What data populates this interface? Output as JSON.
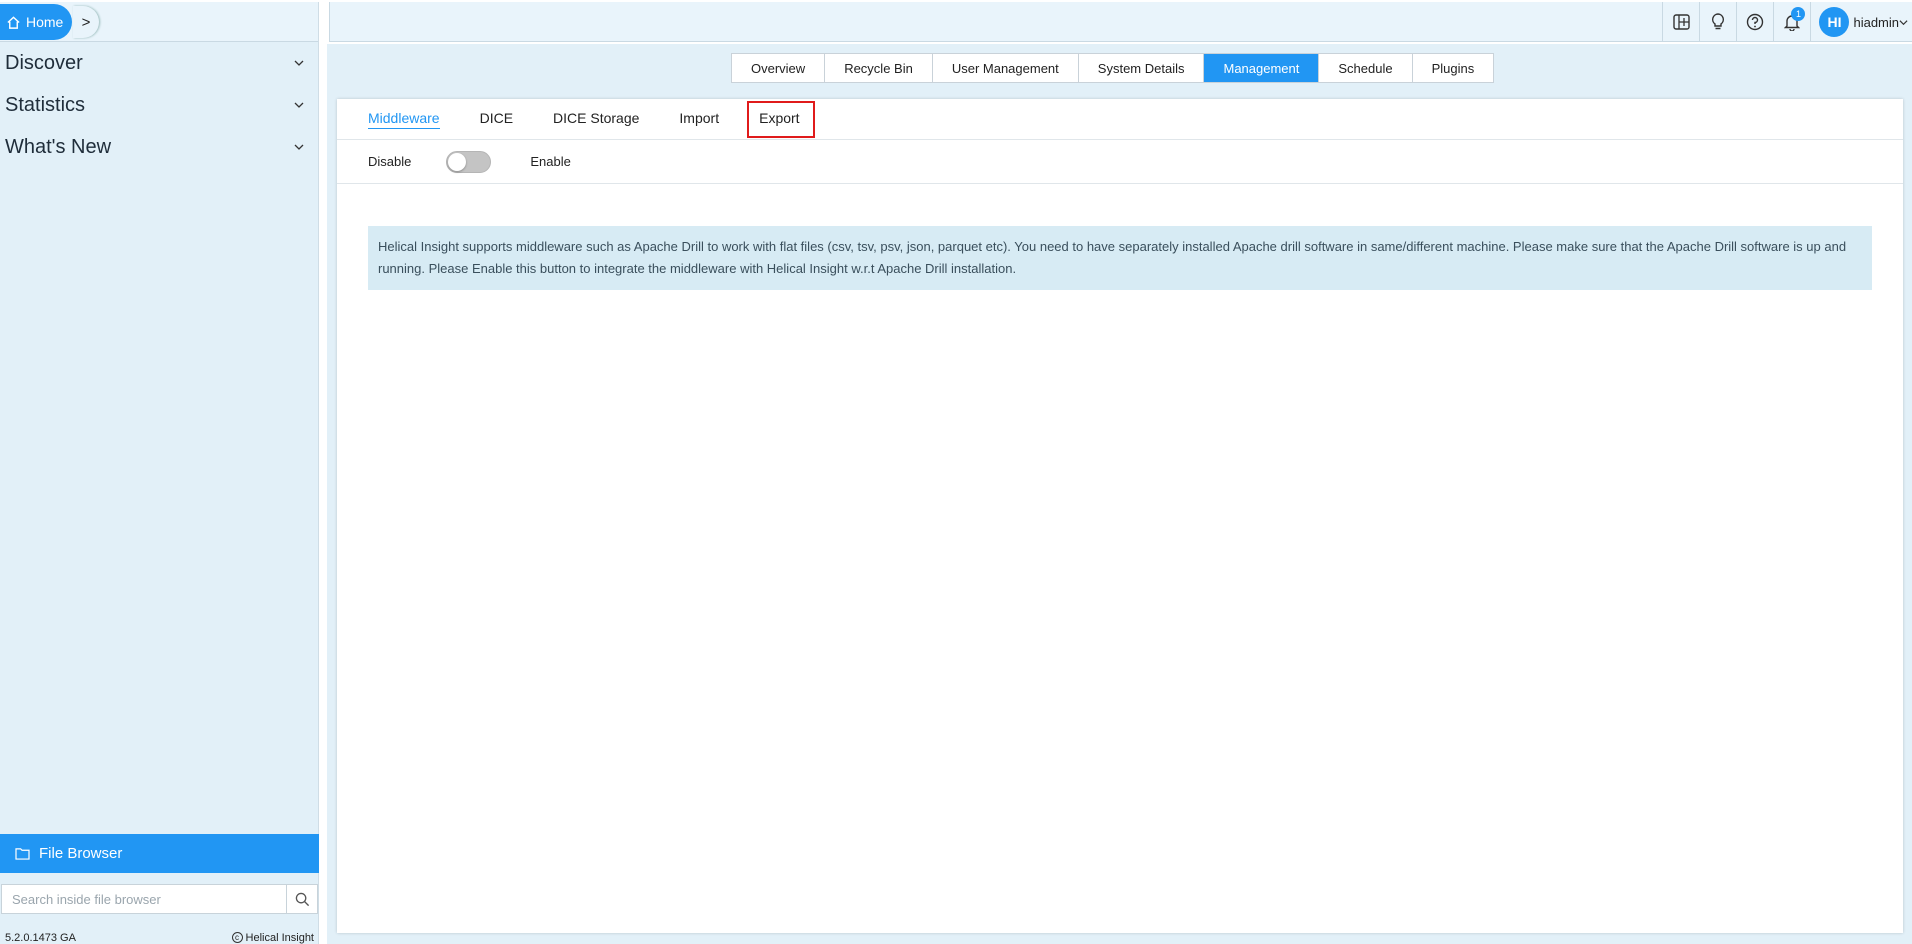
{
  "breadcrumb": {
    "home_label": "Home",
    "next_glyph": ">"
  },
  "sidebar": {
    "items": [
      {
        "label": "Discover"
      },
      {
        "label": "Statistics"
      },
      {
        "label": "What's New"
      }
    ],
    "file_browser_label": "File Browser",
    "search_placeholder": "Search inside file browser",
    "version": "5.2.0.1473 GA",
    "brand": "Helical Insight"
  },
  "header": {
    "notification_count": "1",
    "avatar_initials": "HI",
    "username": "hiadmin"
  },
  "main_tabs": [
    {
      "label": "Overview",
      "active": false
    },
    {
      "label": "Recycle Bin",
      "active": false
    },
    {
      "label": "User Management",
      "active": false
    },
    {
      "label": "System Details",
      "active": false
    },
    {
      "label": "Management",
      "active": true
    },
    {
      "label": "Schedule",
      "active": false
    },
    {
      "label": "Plugins",
      "active": false
    }
  ],
  "sub_tabs": [
    {
      "label": "Middleware",
      "active": true
    },
    {
      "label": "DICE",
      "active": false
    },
    {
      "label": "DICE Storage",
      "active": false
    },
    {
      "label": "Import",
      "active": false
    },
    {
      "label": "Export",
      "active": false
    }
  ],
  "toggle": {
    "off_label": "Disable",
    "on_label": "Enable",
    "enabled": false
  },
  "info_text": "Helical Insight supports middleware such as Apache Drill to work with flat files (csv, tsv, psv, json, parquet etc). You need to have separately installed Apache drill software in same/different machine. Please make sure that the Apache Drill software is up and running. Please Enable this button to integrate the middleware with Helical Insight w.r.t Apache Drill installation.",
  "colors": {
    "accent": "#2196f3",
    "sidebar_bg": "#e2f0f8",
    "highlight": "#e01b1b"
  }
}
